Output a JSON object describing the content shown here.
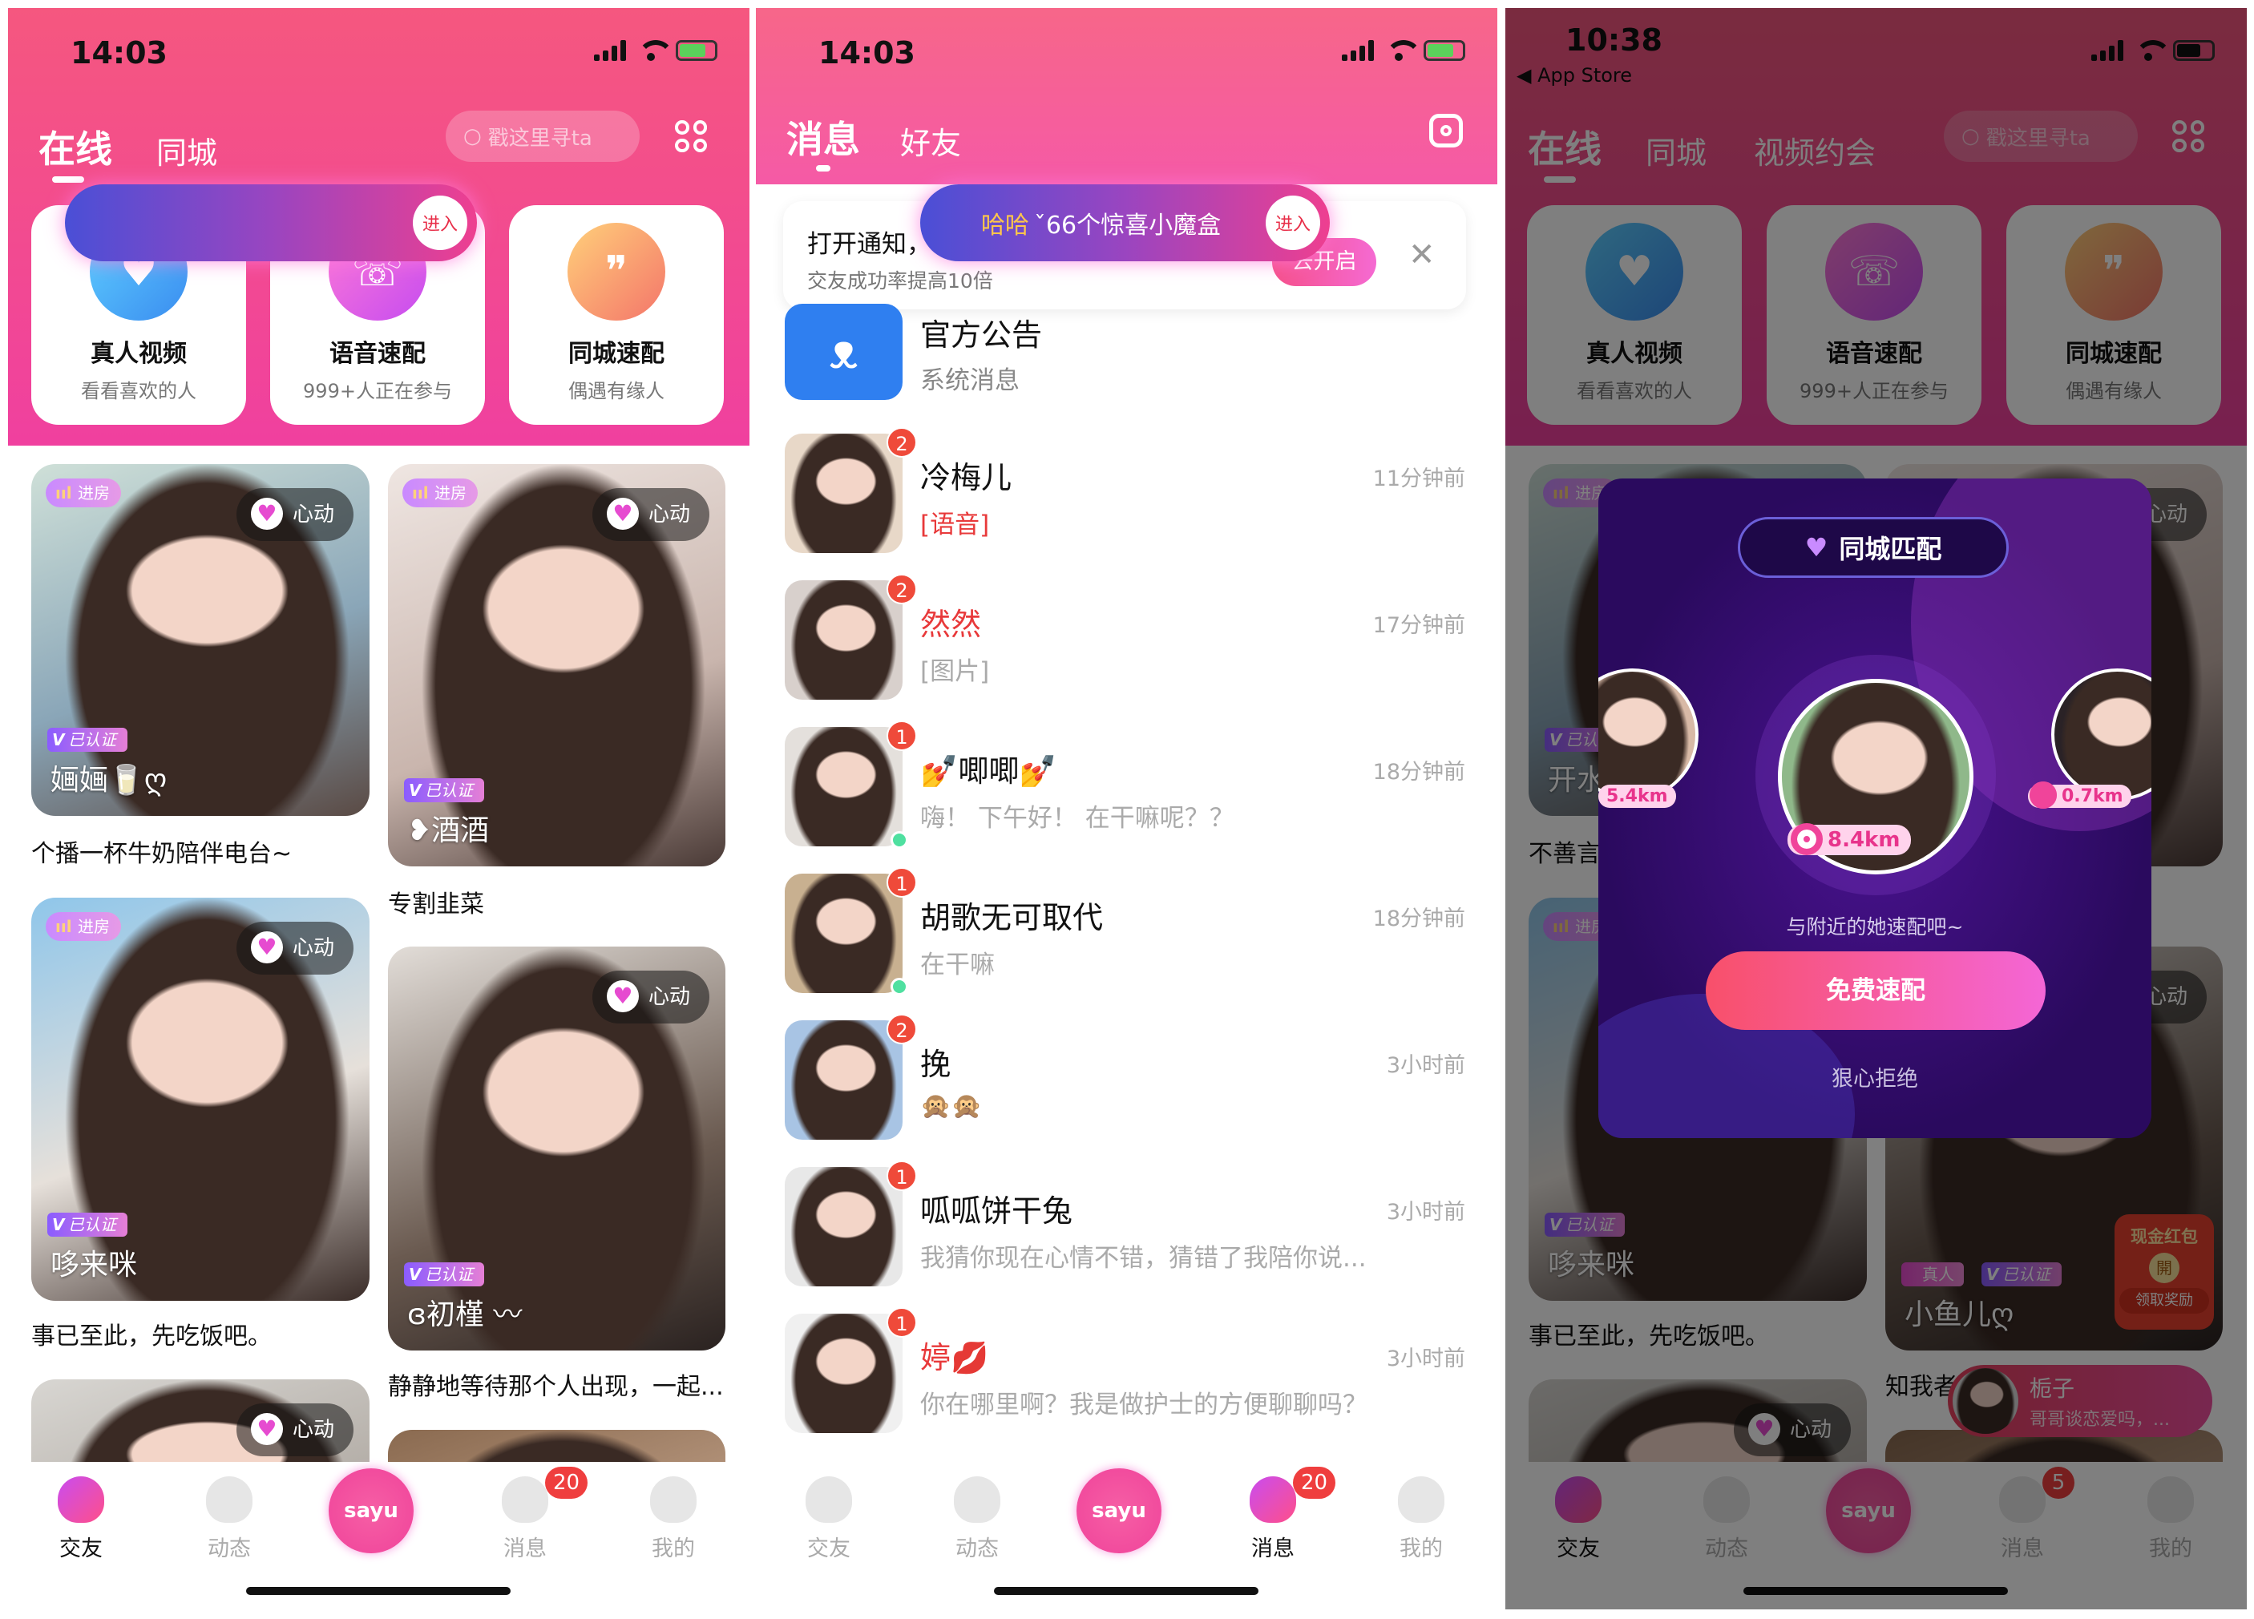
{
  "colors": {
    "brand_pink": "#f24b8e",
    "badge_red": "#ef3e3e",
    "modal_purple": "#2a0a5e"
  },
  "feed_screen": {
    "status_time": "14:03",
    "tabs": [
      "在线",
      "同城"
    ],
    "search_placeholder": "戳这里寻ta",
    "banner_enter": "进入",
    "quick_cards": [
      {
        "title": "真人视频",
        "subtitle": "看看喜欢的人",
        "icon": "video-heart-icon"
      },
      {
        "title": "语音速配",
        "subtitle": "999+人正在参与",
        "icon": "phone-card-icon"
      },
      {
        "title": "同城速配",
        "subtitle": "偶遇有缘人",
        "icon": "voice-bubble-icon"
      }
    ],
    "badges": {
      "enter_room": "进房",
      "heart": "心动",
      "verified": "已认证"
    },
    "posts": [
      {
        "name": "婳婳🥛ღ",
        "caption": "个播一杯牛奶陪伴电台~",
        "room": true,
        "verified": true
      },
      {
        "name": "❥酒酒",
        "caption": "专割韭菜",
        "room": true,
        "verified": true
      },
      {
        "name": "哆来咪",
        "caption": "事已至此，先吃饭吧。",
        "room": true,
        "verified": true
      },
      {
        "name": "ɞ初槿 〰",
        "caption": "静静地等待那个人出现，一起...",
        "room": false,
        "verified": true
      },
      {
        "name": "",
        "caption": "",
        "room": false,
        "verified": false
      },
      {
        "name": "",
        "caption": "",
        "room": false,
        "verified": false,
        "noheart": true
      }
    ],
    "tabbar": {
      "items": [
        "交友",
        "动态",
        "sayu",
        "消息",
        "我的"
      ],
      "active": 0,
      "message_badge": "20"
    }
  },
  "messages_screen": {
    "status_time": "14:03",
    "tabs": [
      "消息",
      "好友"
    ],
    "notice": {
      "title": "打开通知，",
      "subtitle": "交友成功率提高10倍",
      "button": "去开启"
    },
    "banner": {
      "highlight": "哈哈",
      "text": "ˇ66个惊喜小魔盒",
      "enter": "进入"
    },
    "official": {
      "title": "官方公告",
      "subtitle": "系统消息"
    },
    "messages": [
      {
        "name": "冷梅儿",
        "preview": "[语音]",
        "time": "11分钟前",
        "unread": "2",
        "preview_red": true
      },
      {
        "name": "然然",
        "preview": "[图片]",
        "time": "17分钟前",
        "unread": "2",
        "name_red": true
      },
      {
        "name": "💅唧唧💅",
        "preview": "嗨！ 下午好！ 在干嘛呢？？",
        "time": "18分钟前",
        "unread": "1",
        "online": true
      },
      {
        "name": "胡歌无可取代",
        "preview": "在干嘛",
        "time": "18分钟前",
        "unread": "1",
        "online": true
      },
      {
        "name": "挽",
        "preview": "🙊🙊",
        "time": "3小时前",
        "unread": "2"
      },
      {
        "name": "呱呱饼干兔",
        "preview": "我猜你现在心情不错，猜错了我陪你说...",
        "time": "3小时前",
        "unread": "1"
      },
      {
        "name": "婷💋",
        "preview": "你在哪里啊？我是做护士的方便聊聊吗？",
        "time": "3小时前",
        "unread": "1",
        "name_red": true
      }
    ],
    "tabbar": {
      "items": [
        "交友",
        "动态",
        "sayu",
        "消息",
        "我的"
      ],
      "active": 3,
      "message_badge": "20"
    }
  },
  "match_screen": {
    "status_time": "10:38",
    "back_label": "◀ App Store",
    "tabs": [
      "在线",
      "同城",
      "视频约会"
    ],
    "search_placeholder": "戳这里寻ta",
    "quick_cards": [
      {
        "title": "真人视频",
        "subtitle": "看看喜欢的人"
      },
      {
        "title": "语音速配",
        "subtitle": "999+人正在参与"
      },
      {
        "title": "同城速配",
        "subtitle": "偶遇有缘人"
      }
    ],
    "posts": [
      {
        "name": "开水",
        "caption": "不善言",
        "room": true,
        "verified": true
      },
      {
        "name": "",
        "caption": "",
        "room": false,
        "verified": false
      },
      {
        "name": "哆来咪",
        "caption": "事已至此，先吃饭吧。",
        "room": true,
        "verified": true
      },
      {
        "name": "小鱼儿ღ",
        "caption": "知我者",
        "room": false,
        "verified": true,
        "real": "真人"
      },
      {
        "name": "",
        "caption": "",
        "room": false,
        "verified": false
      },
      {
        "name": "",
        "caption": "",
        "room": false,
        "verified": false,
        "noheart": true
      }
    ],
    "red_packet": {
      "title": "现金红包",
      "open": "開",
      "claim": "领取奖励"
    },
    "toast": {
      "name": "栀子",
      "text": "哥哥谈恋爱吗，..."
    },
    "modal": {
      "title": "同城匹配",
      "distances": [
        "5.4km",
        "8.4km",
        "0.7km"
      ],
      "hint": "与附近的她速配吧~",
      "primary": "免费速配",
      "decline": "狠心拒绝"
    },
    "tabbar": {
      "items": [
        "交友",
        "动态",
        "sayu",
        "消息",
        "我的"
      ],
      "active": 0,
      "message_badge": "5"
    }
  }
}
